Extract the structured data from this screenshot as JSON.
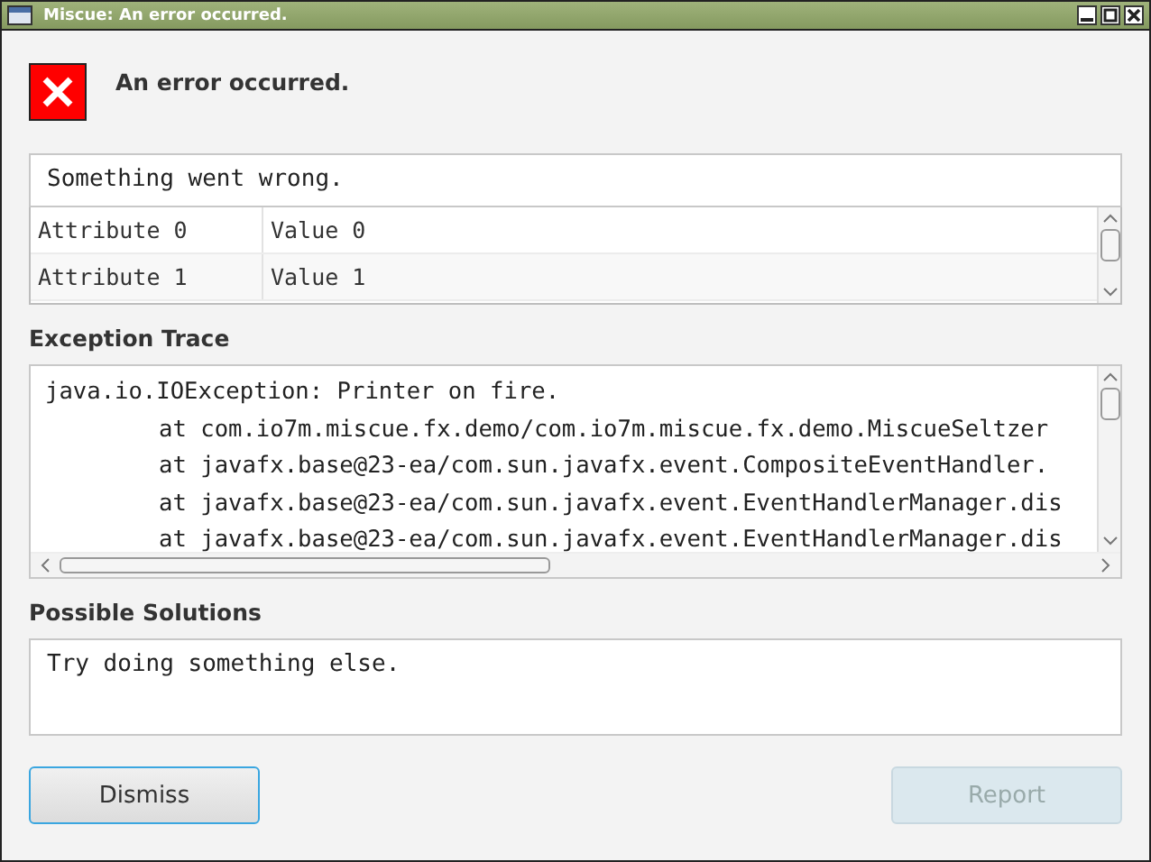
{
  "window": {
    "title": "Miscue: An error occurred."
  },
  "heading": "An error occurred.",
  "message": "Something went wrong.",
  "attributes": [
    {
      "name": "Attribute 0",
      "value": "Value 0"
    },
    {
      "name": "Attribute 1",
      "value": "Value 1"
    }
  ],
  "exception_trace": {
    "label": "Exception Trace",
    "lines": [
      {
        "kind": "message",
        "text": "java.io.IOException: Printer on fire."
      },
      {
        "kind": "frame",
        "text": "at com.io7m.miscue.fx.demo/com.io7m.miscue.fx.demo.MiscueSeltzer"
      },
      {
        "kind": "frame",
        "text": "at javafx.base@23-ea/com.sun.javafx.event.CompositeEventHandler."
      },
      {
        "kind": "frame",
        "text": "at javafx.base@23-ea/com.sun.javafx.event.EventHandlerManager.dis"
      },
      {
        "kind": "frame",
        "text": "at javafx.base@23-ea/com.sun.javafx.event.EventHandlerManager.dis"
      }
    ]
  },
  "possible_solutions": {
    "label": "Possible Solutions",
    "text": "Try doing something else."
  },
  "buttons": [
    {
      "label": "Dismiss",
      "focused": true,
      "disabled": false
    },
    {
      "label": "Report",
      "focused": false,
      "disabled": true
    }
  ]
}
